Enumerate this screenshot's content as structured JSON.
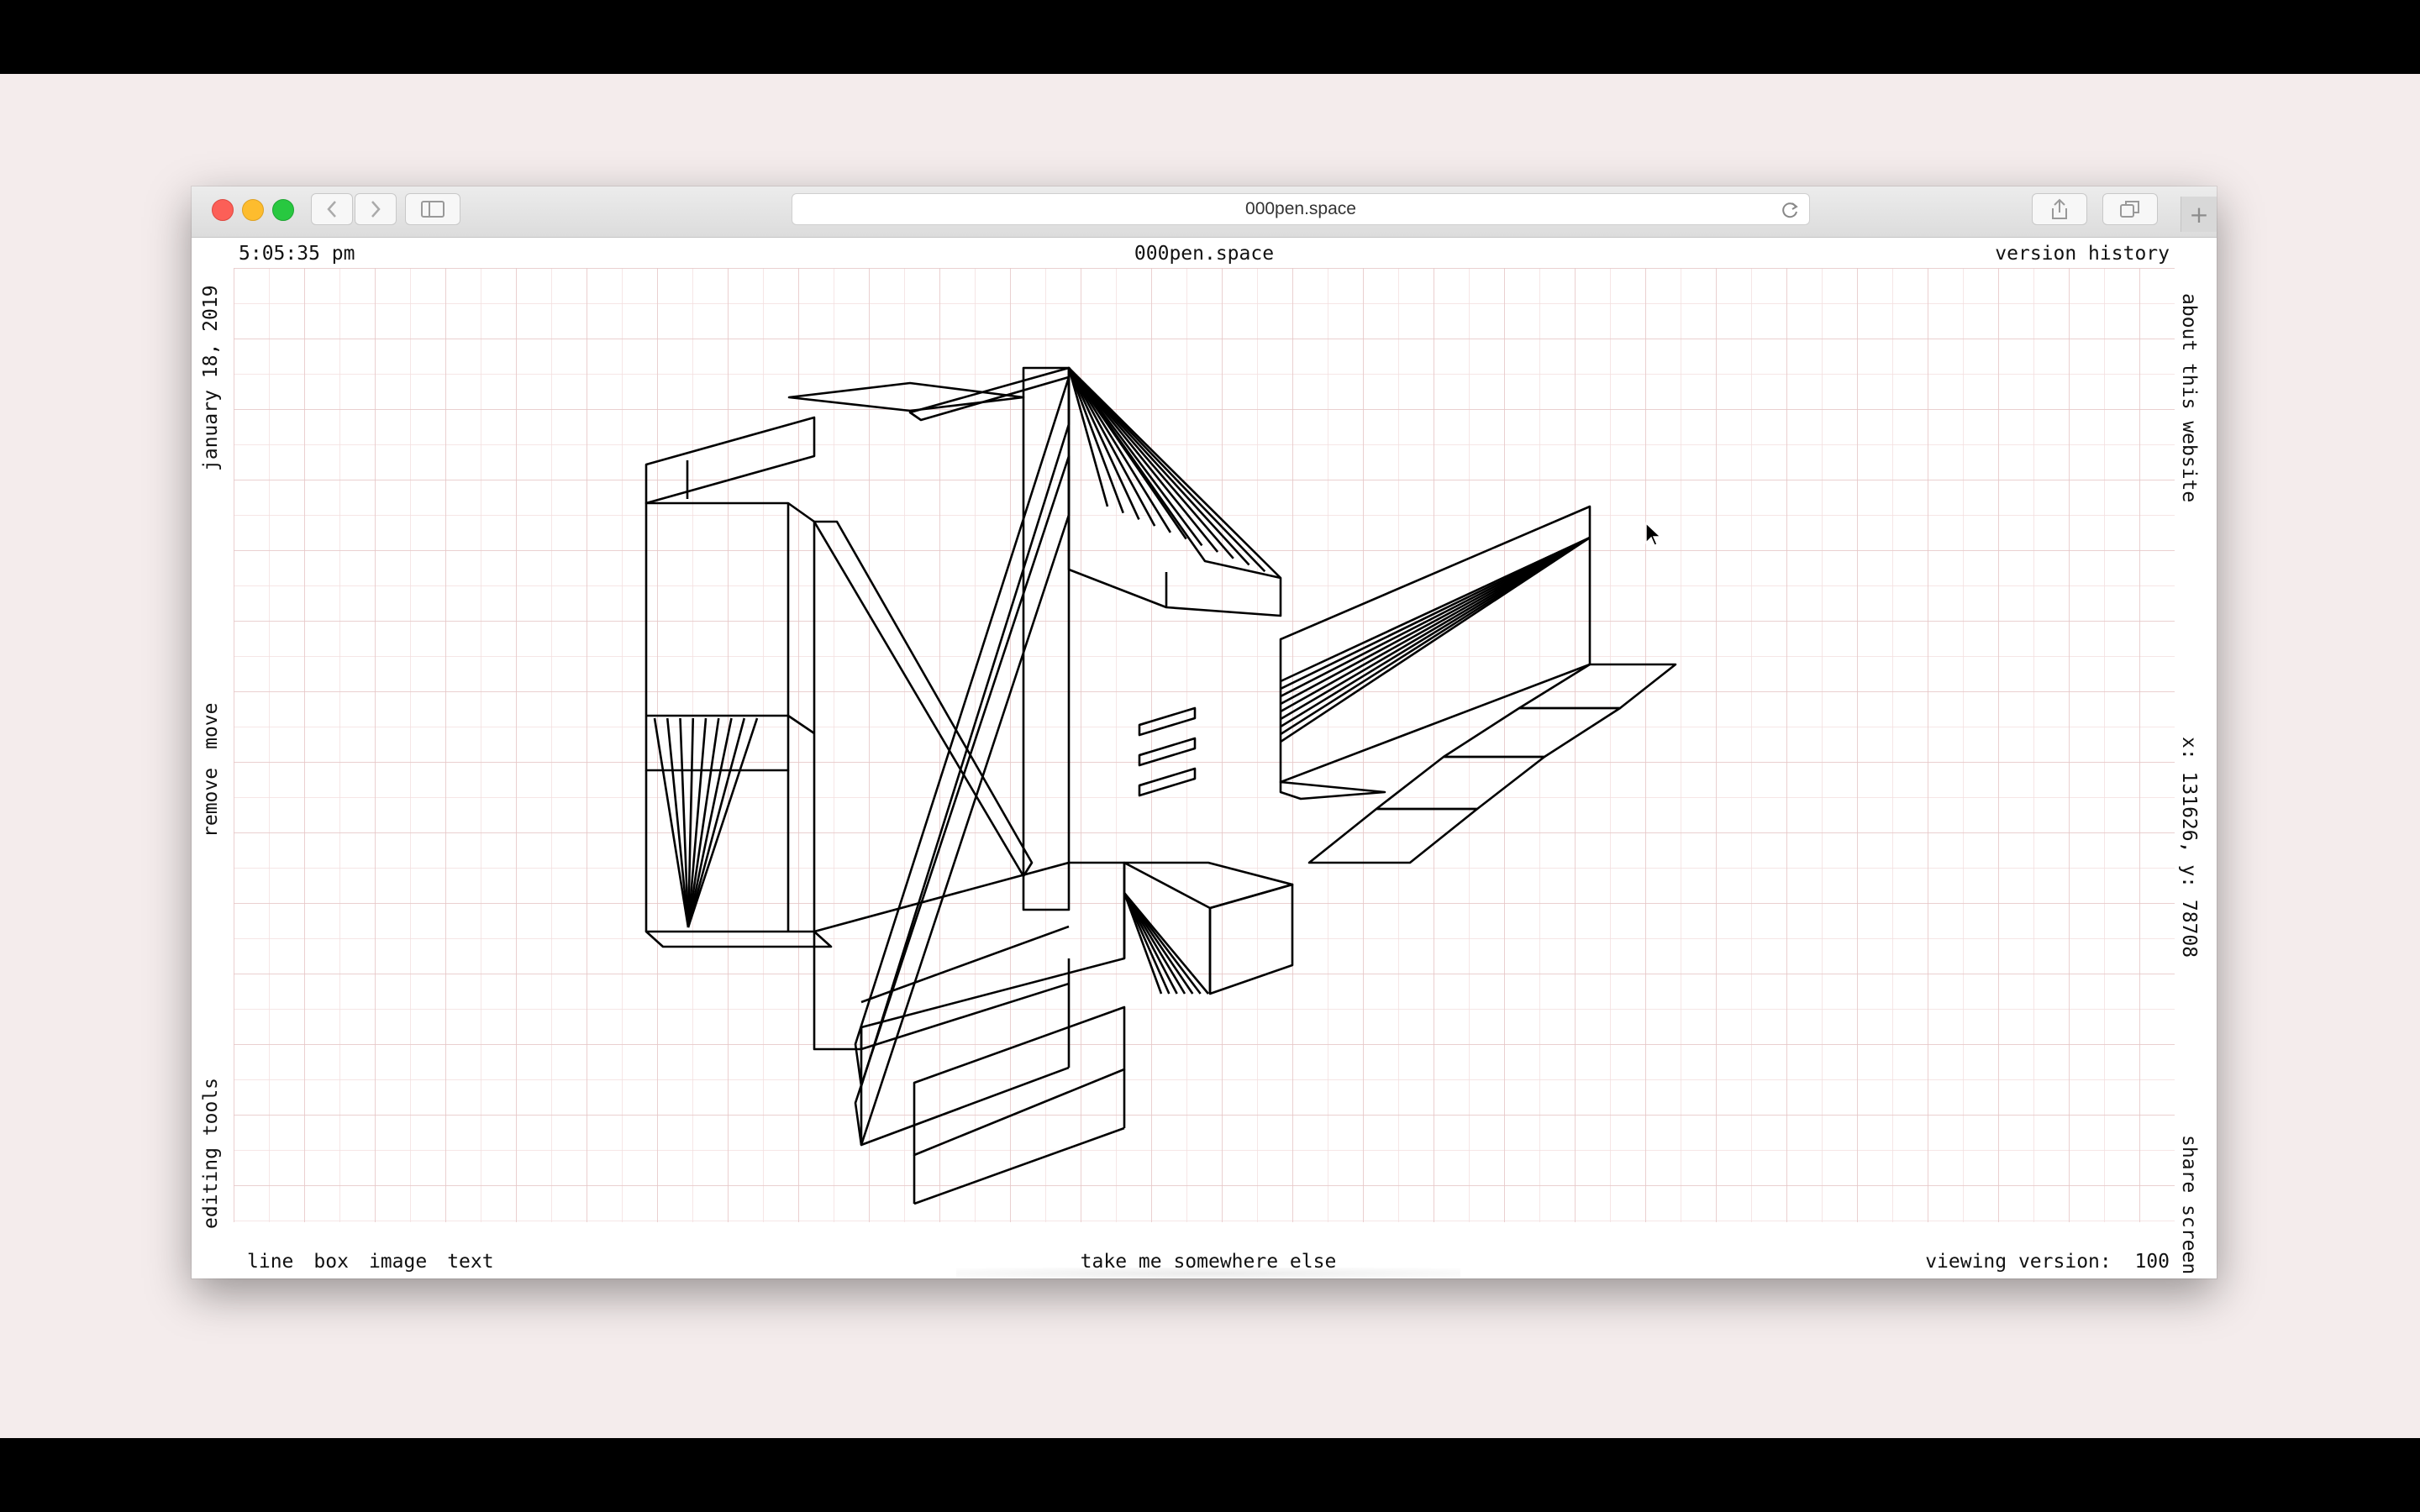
{
  "browser": {
    "url": "000pen.space",
    "icons": {
      "back": "chevron-left-icon",
      "forward": "chevron-right-icon",
      "sidebar": "sidebar-icon",
      "reload": "reload-icon",
      "share": "share-icon",
      "tabs": "tabs-icon",
      "new_tab": "plus-icon"
    }
  },
  "page": {
    "time": "5:05:35 pm",
    "site_title": "000pen.space",
    "version_history": "version history",
    "date": "january 18, 2019",
    "edit_actions": [
      "move",
      "remove"
    ],
    "editing_tools": "editing tools",
    "about": "about this website",
    "coordinates": "x: 131626,  y: 78708",
    "share_screen": "share screen",
    "tools": [
      "line",
      "box",
      "image",
      "text"
    ],
    "take_me": "take me somewhere else",
    "viewing_version_label": "viewing version:",
    "viewing_version_value": "100"
  },
  "colors": {
    "grid_minor": "#f3dede",
    "grid_major": "#e6c6c6",
    "ink": "#000000",
    "backdrop": "#f4ecec"
  }
}
